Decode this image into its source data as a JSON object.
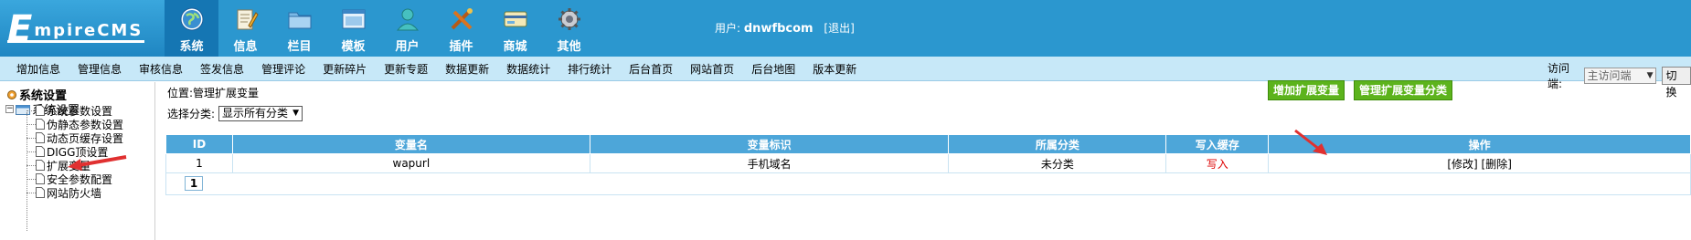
{
  "header": {
    "logo": {
      "first": "E",
      "rest": "mpireCMS"
    },
    "nav": [
      {
        "label": "系统",
        "icon": "globe-icon"
      },
      {
        "label": "信息",
        "icon": "notepad-icon"
      },
      {
        "label": "栏目",
        "icon": "folder-icon"
      },
      {
        "label": "模板",
        "icon": "window-icon"
      },
      {
        "label": "用户",
        "icon": "user-icon"
      },
      {
        "label": "插件",
        "icon": "tools-icon"
      },
      {
        "label": "商城",
        "icon": "card-icon"
      },
      {
        "label": "其他",
        "icon": "gear-icon"
      }
    ],
    "user_label": "用户:",
    "username": "dnwfbcom",
    "logout": "[退出]"
  },
  "submenu": {
    "items": [
      "增加信息",
      "管理信息",
      "审核信息",
      "签发信息",
      "管理评论",
      "更新碎片",
      "更新专题",
      "数据更新",
      "数据统计",
      "排行统计",
      "后台首页",
      "网站首页",
      "后台地图",
      "版本更新"
    ],
    "access_label": "访问端:",
    "access_value": "主访问端",
    "switch_button": "切换"
  },
  "tree": {
    "root": "系统设置",
    "folder": "系统设置",
    "items": [
      "系统参数设置",
      "伪静态参数设置",
      "动态页缓存设置",
      "DIGG顶设置",
      "扩展变量",
      "安全参数配置",
      "网站防火墙"
    ]
  },
  "content": {
    "position_label": "位置:",
    "position_link": "管理扩展变量",
    "add_button": "增加扩展变量",
    "manage_cat_button": "管理扩展变量分类",
    "filter_label": "选择分类:",
    "filter_value": "显示所有分类",
    "table": {
      "headers": [
        "ID",
        "变量名",
        "变量标识",
        "所属分类",
        "写入缓存",
        "操作"
      ],
      "rows": [
        {
          "id": "1",
          "name": "wapurl",
          "label": "手机域名",
          "category": "未分类",
          "cache": "写入",
          "edit": "[修改]",
          "delete": "[删除]"
        }
      ]
    },
    "page": "1"
  },
  "colors": {
    "header_bg": "#2b97cf",
    "submenu_bg": "#c7e8f8",
    "table_header": "#4da6d9",
    "green_button": "#5cb31c",
    "annotation_arrow": "#e03030"
  }
}
